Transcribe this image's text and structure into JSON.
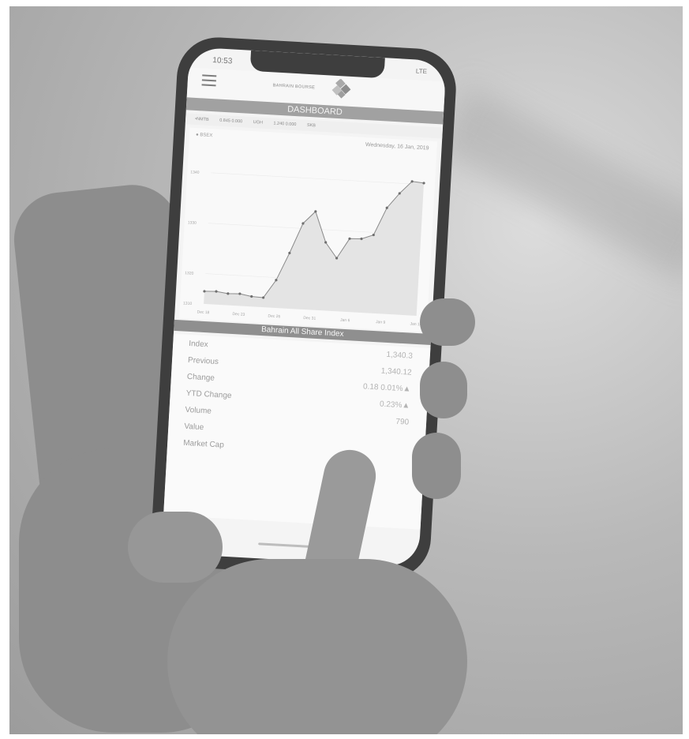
{
  "status": {
    "time": "10:53",
    "right": "LTE"
  },
  "header": {
    "logo_text": "BAHRAIN BOURSE",
    "title": "DASHBOARD"
  },
  "ticker": [
    {
      "sym": "•NMTB",
      "vals": "0.845  0.000"
    },
    {
      "sym": "UGH",
      "vals": "1.240  0.000"
    },
    {
      "sym": "SKB",
      "vals": ""
    }
  ],
  "chart": {
    "legend": "● BSEX",
    "date": "Wednesday, 16 Jan, 2019",
    "x_labels": [
      "Dec 18",
      "Dec 23",
      "Dec 26",
      "Dec 31",
      "Jan 6",
      "Jan 9",
      "Jan 16"
    ],
    "y_labels": [
      "1340",
      "1330",
      "1320",
      "1310"
    ]
  },
  "chart_data": {
    "type": "area",
    "x": [
      1,
      2,
      3,
      4,
      5,
      6,
      7,
      8,
      9,
      10,
      11,
      12,
      13,
      14,
      15,
      16,
      17,
      18,
      19
    ],
    "values": [
      1316.5,
      1316.6,
      1316.3,
      1316.4,
      1316.0,
      1315.9,
      1319.5,
      1325.0,
      1331.0,
      1333.5,
      1327.5,
      1324.5,
      1328.5,
      1328.6,
      1329.5,
      1335.0,
      1338.0,
      1340.5,
      1340.3
    ],
    "x_tick_labels": [
      "Dec 18",
      "Dec 23",
      "Dec 26",
      "Dec 31",
      "Jan 6",
      "Jan 9",
      "Jan 16"
    ],
    "y_tick_labels": [
      "1340",
      "1330",
      "1320",
      "1310"
    ],
    "ylim": [
      1314,
      1344
    ],
    "legend": [
      "BSEX"
    ],
    "title": "Wednesday, 16 Jan, 2019"
  },
  "index": {
    "title": "Bahrain All Share Index",
    "rows": [
      {
        "label": "Index",
        "value": "1,340.3"
      },
      {
        "label": "Previous",
        "value": "1,340.12"
      },
      {
        "label": "Change",
        "value": "0.18  0.01%▲"
      },
      {
        "label": "YTD Change",
        "value": "0.23%▲"
      },
      {
        "label": "Volume",
        "value": "790"
      },
      {
        "label": "Value",
        "value": ""
      },
      {
        "label": "Market Cap",
        "value": ""
      }
    ]
  }
}
